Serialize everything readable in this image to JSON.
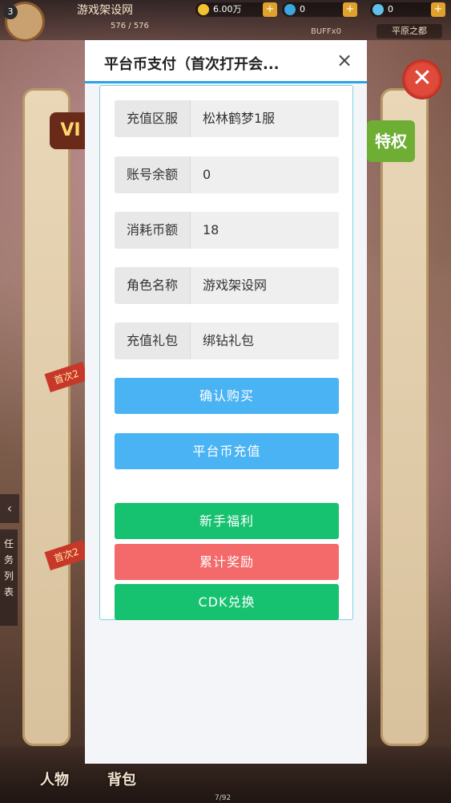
{
  "hud": {
    "level": "3",
    "player_name": "游戏架设网",
    "hp": "576 / 576",
    "currency_gold": "6.00万",
    "currency_diamond": "0",
    "currency_bind": "0",
    "buff": "BUFFx0",
    "zone": "平原之都",
    "plus": "+"
  },
  "background": {
    "vip": "VI",
    "privilege": "特权",
    "first_charge_ribbon_1": "首次2",
    "first_charge_ribbon_2": "首次2",
    "side_tab_text": "任务列表",
    "side_arrow": "‹",
    "bottom_tab_character": "人物",
    "bottom_tab_bag": "背包",
    "bottom_page": "7/92"
  },
  "dialog": {
    "title": "平台币支付（首次打开会...",
    "close_icon": "×",
    "fields": [
      {
        "label": "充值区服",
        "value": "松林鹤梦1服"
      },
      {
        "label": "账号余额",
        "value": "0"
      },
      {
        "label": "消耗币额",
        "value": "18"
      },
      {
        "label": "角色名称",
        "value": "游戏架设网"
      },
      {
        "label": "充值礼包",
        "value": "绑钻礼包"
      }
    ],
    "buttons": {
      "confirm": "确认购买",
      "recharge": "平台币充值",
      "newbie": "新手福利",
      "cumulative": "累计奖励",
      "cdk": "CDK兑换"
    },
    "colors": {
      "blue": "#4ab3f4",
      "green": "#16c270",
      "red": "#f46a6a",
      "header_accent": "#30a1e6"
    }
  }
}
